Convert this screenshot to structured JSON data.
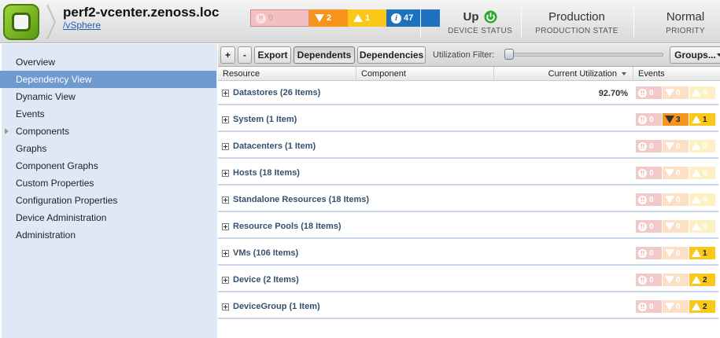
{
  "header": {
    "device_title": "perf2-vcenter.zenoss.loc",
    "device_class": "/vSphere",
    "events": {
      "critical": "0",
      "error": "2",
      "warning": "1",
      "info": "47"
    },
    "device_status": {
      "value": "Up",
      "label": "DEVICE STATUS"
    },
    "production_state": {
      "value": "Production",
      "label": "PRODUCTION STATE"
    },
    "priority": {
      "value": "Normal",
      "label": "PRIORITY"
    }
  },
  "sidebar": {
    "items": [
      {
        "label": "Overview"
      },
      {
        "label": "Dependency View"
      },
      {
        "label": "Dynamic View"
      },
      {
        "label": "Events"
      },
      {
        "label": "Components"
      },
      {
        "label": "Graphs"
      },
      {
        "label": "Component Graphs"
      },
      {
        "label": "Custom Properties"
      },
      {
        "label": "Configuration Properties"
      },
      {
        "label": "Device Administration"
      },
      {
        "label": "Administration"
      }
    ],
    "active_index": 1
  },
  "toolbar": {
    "add_label": "+",
    "remove_label": "-",
    "export_label": "Export",
    "dependents_label": "Dependents",
    "dependencies_label": "Dependencies",
    "utilization_filter_label": "Utilization Filter:",
    "groups_label": "Groups..."
  },
  "table": {
    "columns": {
      "resource": "Resource",
      "component": "Component",
      "utilization": "Current Utilization",
      "events": "Events"
    },
    "rows": [
      {
        "label": "Datastores (26 Items)",
        "utilization": "92.70%",
        "critical": "0",
        "error": "0",
        "warning": "0",
        "error_on": false,
        "warning_on": false
      },
      {
        "label": "System (1 Item)",
        "utilization": "",
        "critical": "0",
        "error": "3",
        "warning": "1",
        "error_on": true,
        "warning_on": true
      },
      {
        "label": "Datacenters (1 Item)",
        "utilization": "",
        "critical": "0",
        "error": "0",
        "warning": "0",
        "error_on": false,
        "warning_on": false
      },
      {
        "label": "Hosts (18 Items)",
        "utilization": "",
        "critical": "0",
        "error": "0",
        "warning": "0",
        "error_on": false,
        "warning_on": false
      },
      {
        "label": "Standalone Resources (18 Items)",
        "utilization": "",
        "critical": "0",
        "error": "0",
        "warning": "0",
        "error_on": false,
        "warning_on": false
      },
      {
        "label": "Resource Pools (18 Items)",
        "utilization": "",
        "critical": "0",
        "error": "0",
        "warning": "0",
        "error_on": false,
        "warning_on": false
      },
      {
        "label": "VMs (106 Items)",
        "utilization": "",
        "critical": "0",
        "error": "0",
        "warning": "1",
        "error_on": false,
        "warning_on": true
      },
      {
        "label": "Device (2 Items)",
        "utilization": "",
        "critical": "0",
        "error": "0",
        "warning": "2",
        "error_on": false,
        "warning_on": true
      },
      {
        "label": "DeviceGroup (1 Item)",
        "utilization": "",
        "critical": "0",
        "error": "0",
        "warning": "2",
        "error_on": false,
        "warning_on": true
      }
    ]
  },
  "colors": {
    "critical": "#f2c0c0",
    "error": "#f7941d",
    "warning": "#f9c81a",
    "info": "#1e72bd",
    "status_up": "#2ea82e",
    "sidebar_active": "#6f9acf"
  }
}
